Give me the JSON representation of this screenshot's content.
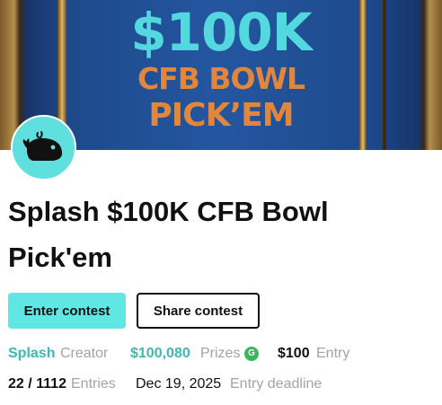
{
  "banner": {
    "amount": "$100K",
    "line2": "CFB BOWL",
    "line3": "PICK’EM"
  },
  "contest": {
    "title": "Splash $100K CFB Bowl Pick'em"
  },
  "buttons": {
    "enter_label": "Enter contest",
    "share_label": "Share contest"
  },
  "meta": {
    "creator_name": "Splash",
    "creator_label": "Creator",
    "prizes_value": "$100,080",
    "prizes_label": "Prizes",
    "prize_badge": "G",
    "entry_value": "$100",
    "entry_label": "Entry",
    "entries_value": "22 / 1112",
    "entries_label": "Entries",
    "deadline_value": "Dec 19, 2025",
    "deadline_label": "Entry deadline"
  },
  "colors": {
    "accent": "#5fe7e3",
    "teal_text": "#3fb7b4",
    "badge_green": "#3db35a",
    "banner_blue": "#1f4d8e",
    "banner_orange": "#e0873d"
  },
  "icons": {
    "avatar": "whale-icon",
    "badge": "gold-coin-icon"
  }
}
